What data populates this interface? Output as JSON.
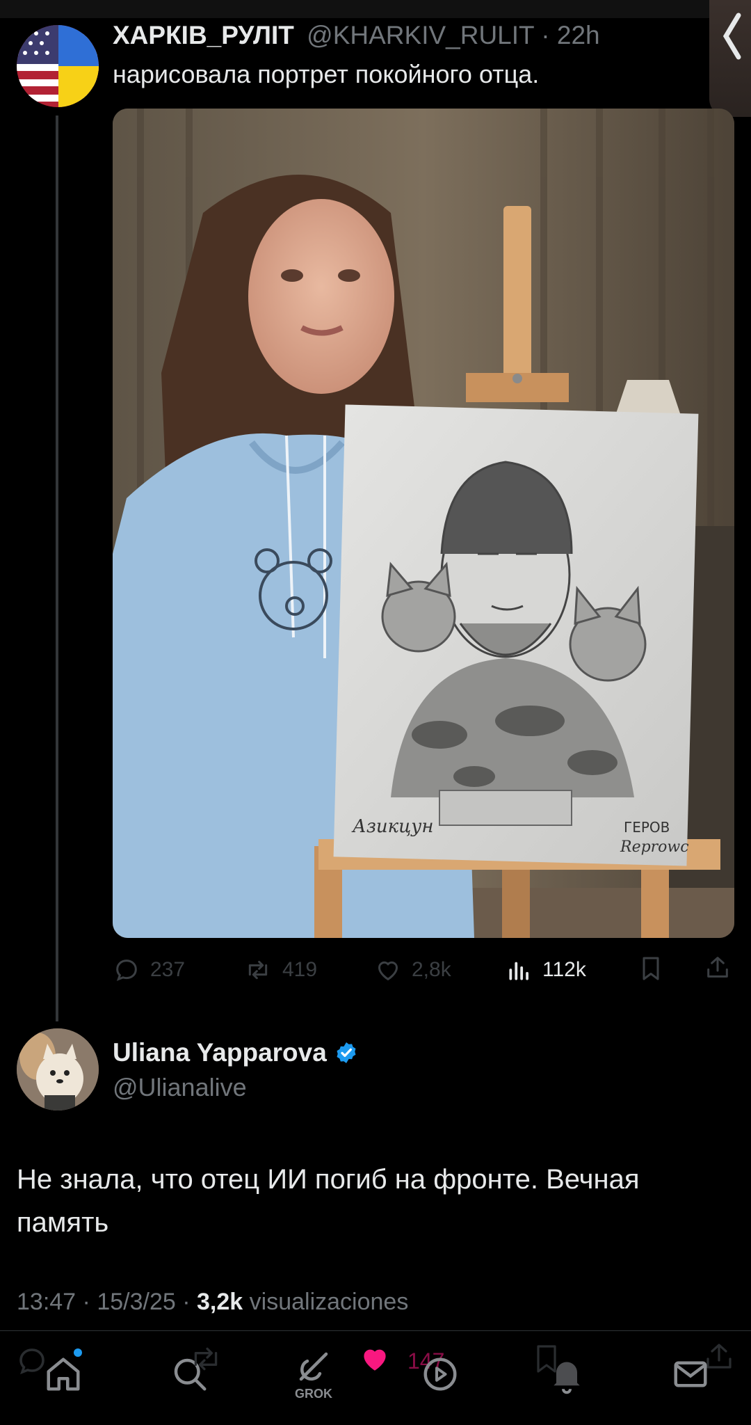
{
  "parent_tweet": {
    "display_name": "ХАРКІВ_РУЛІТ",
    "handle": "@KHARKIV_RULIT",
    "separator": "·",
    "time": "22h",
    "text": "нарисовала портрет покойного отца.",
    "portrait_signature_left": "Азикцун",
    "portrait_signature_right_line1": "ГЕРОВ",
    "portrait_signature_right_line2": "Reprowc",
    "actions": {
      "replies": "237",
      "retweets": "419",
      "likes": "2,8k",
      "views": "112k"
    }
  },
  "reply_tweet": {
    "display_name": "Uliana Yapparova",
    "handle": "@Ulianalive",
    "verified": true,
    "text_line1": "Не знала, что отец ИИ погиб на фронте. Вечная",
    "text_line2": "память",
    "time": "13:47",
    "date": "15/3/25",
    "views_count": "3,2k",
    "views_label": "visualizaciones"
  },
  "bottom_nav": {
    "grok_label": "GROK",
    "like_count": "147"
  },
  "colors": {
    "accent": "#1d9bf0",
    "like_pink": "#f91880",
    "background": "#000000"
  }
}
